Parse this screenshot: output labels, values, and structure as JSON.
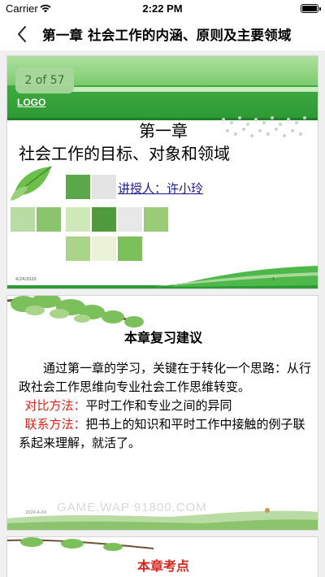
{
  "status_bar": {
    "carrier": "Carrier",
    "time": "2:22 PM"
  },
  "nav": {
    "title": "第一章 社会工作的内涵、原则及主要领域"
  },
  "slides": [
    {
      "page_badge": "2 of 57",
      "logo": "LOGO",
      "title_line1": "第一章",
      "title_line2": "社会工作的目标、对象和领域",
      "lecturer": "讲授人：许小玲",
      "footer_date": "4/24/2020",
      "footer_page": "1"
    },
    {
      "heading": "本章复习建议",
      "paragraph": "通过第一章的学习，关键在于转化一个思路：从行政社会工作思维向专业社会工作思维转变。",
      "compare_label": "对比方法：",
      "compare_text": "平时工作和专业之间的异同",
      "link_label": "联系方法：",
      "link_text": "把书上的知识和平时工作中接触的例子联系起来理解，就活了。",
      "footer_date": "2020-4-24"
    },
    {
      "heading": "本章考点"
    }
  ],
  "watermark": "GAME.WAP 91800.COM",
  "colors": {
    "green_dark": "#2e9a35",
    "green_light": "#a8d89a",
    "red": "#d9261c",
    "link_blue": "#1a1a8c"
  },
  "battery_level_percent": 100
}
